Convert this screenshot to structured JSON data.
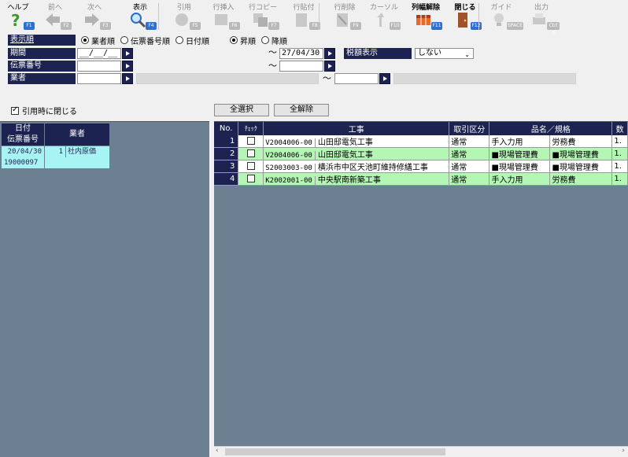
{
  "toolbar": [
    {
      "label": "ヘルプ",
      "key": "F1",
      "icon": "help-icon",
      "enabled": true
    },
    {
      "label": "前へ",
      "key": "F2",
      "icon": "arrow-left-icon",
      "enabled": false
    },
    {
      "label": "次へ",
      "key": "F3",
      "icon": "arrow-right-icon",
      "enabled": false
    },
    {
      "label": "表示",
      "key": "F4",
      "icon": "magnifier-icon",
      "enabled": true
    },
    {
      "label": "引用",
      "key": "F5",
      "icon": "quote-icon",
      "enabled": false
    },
    {
      "label": "行挿入",
      "key": "F6",
      "icon": "row-insert-icon",
      "enabled": false
    },
    {
      "label": "行コピー",
      "key": "F7",
      "icon": "row-copy-icon",
      "enabled": false
    },
    {
      "label": "行貼付",
      "key": "F8",
      "icon": "row-paste-icon",
      "enabled": false
    },
    {
      "label": "行削除",
      "key": "F9",
      "icon": "row-delete-icon",
      "enabled": false
    },
    {
      "label": "カーソル",
      "key": "F10",
      "icon": "cursor-icon",
      "enabled": false
    },
    {
      "label": "列幅解除",
      "key": "F11",
      "icon": "column-width-icon",
      "enabled": true
    },
    {
      "label": "閉じる",
      "key": "F12",
      "icon": "door-icon",
      "enabled": true
    },
    {
      "label": "ガイド",
      "key": "SPACE",
      "icon": "lightbulb-icon",
      "enabled": false
    },
    {
      "label": "出力",
      "key": "Ctrl P",
      "icon": "output-icon",
      "enabled": false
    }
  ],
  "form": {
    "order_label": "表示順",
    "order_options": [
      "業者順",
      "伝票番号順",
      "日付順"
    ],
    "order_selected": 0,
    "direction_options": [
      "昇順",
      "降順"
    ],
    "direction_selected": 0,
    "period_label": "期間",
    "period_from": "__/__/__",
    "period_to": "27/04/30",
    "tax_label": "税額表示",
    "tax_value": "しない",
    "slip_label": "伝票番号",
    "vendor_label": "業者",
    "tilde": "～"
  },
  "close_on_quote": {
    "label": "引用時に閉じる",
    "checked": true
  },
  "buttons": {
    "select_all": "全選択",
    "deselect_all": "全解除"
  },
  "left_table": {
    "header_date": "日付",
    "header_slip": "伝票番号",
    "header_vendor": "業者",
    "rows": [
      {
        "date": "20/04/30",
        "slip": "19000097",
        "vendor_num": "1",
        "vendor": "社内原価"
      }
    ]
  },
  "grid": {
    "headers": [
      "No.",
      "ﾁｪｯｸ",
      "工事",
      "取引区分",
      "品名／規格",
      "数"
    ],
    "rows": [
      {
        "no": "1",
        "code": "V2004006-00",
        "name": "山田邸電気工事",
        "kubun": "通常",
        "hinmei": "手入力用",
        "kikaku": "労務費",
        "qty": "1."
      },
      {
        "no": "2",
        "code": "V2004006-00",
        "name": "山田邸電気工事",
        "kubun": "通常",
        "hinmei": "■現場管理費",
        "kikaku": "■現場管理費",
        "qty": "1."
      },
      {
        "no": "3",
        "code": "S2003003-00",
        "name": "横浜市中区天池町維持修繕工事",
        "kubun": "通常",
        "hinmei": "■現場管理費",
        "kikaku": "■現場管理費",
        "qty": "1."
      },
      {
        "no": "4",
        "code": "K2002001-00",
        "name": "中央駅南新築工事",
        "kubun": "通常",
        "hinmei": "手入力用",
        "kikaku": "労務費",
        "qty": "1."
      }
    ]
  },
  "colors": {
    "header_navy": "#1d2350",
    "panel_gray": "#6d8091",
    "row_green": "#b4f7b4",
    "left_cyan": "#a8f4f4"
  }
}
